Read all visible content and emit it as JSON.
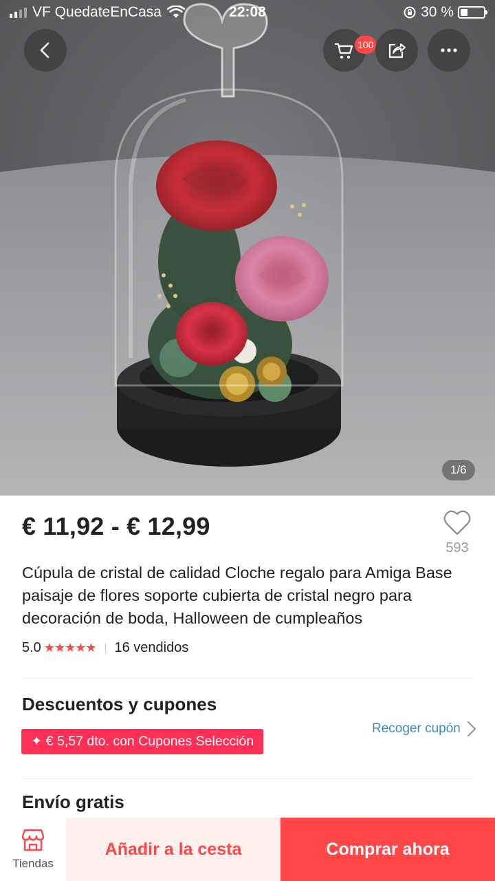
{
  "status_bar": {
    "carrier": "VF QuedateEnCasa",
    "time": "22:08",
    "battery": "30 %",
    "battery_level": 0.3
  },
  "header": {
    "back_icon": "chevron-left-icon",
    "cart_icon": "cart-icon",
    "cart_badge": "100",
    "share_icon": "share-icon",
    "more_icon": "more-dots-icon"
  },
  "gallery": {
    "counter": "1/6"
  },
  "product": {
    "price": "€ 11,92 - € 12,99",
    "wishlist_count": "593",
    "title": "Cúpula de cristal de calidad Cloche regalo para Amiga Base paisaje de flores soporte cubierta de cristal negro para decoración de boda, Halloween de cumpleaños",
    "rating": "5.0",
    "stars": 5,
    "stars_text": "★★★★★",
    "sold": "16 vendidos"
  },
  "coupons": {
    "section_title": "Descuentos y cupones",
    "tag": "✦ € 5,57 dto. con Cupones Selección",
    "link": "Recoger cupón"
  },
  "shipping": {
    "section_title": "Envío gratis"
  },
  "bottom_bar": {
    "stores_label": "Tiendas",
    "add_to_cart": "Añadir a la cesta",
    "buy_now": "Comprar ahora"
  },
  "colors": {
    "accent": "#ff4747",
    "coupon": "#ff2f57",
    "link": "#3e8cc4",
    "add_cart_bg": "#fff1ee"
  }
}
